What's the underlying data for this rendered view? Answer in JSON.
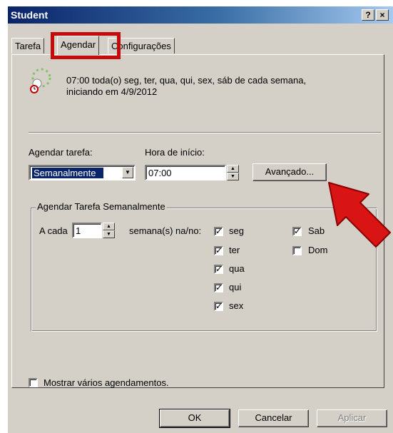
{
  "window": {
    "title": "Student",
    "help_label": "?",
    "close_label": "×"
  },
  "tabs": [
    {
      "label": "Tarefa"
    },
    {
      "label": "Agendar"
    },
    {
      "label": "Configurações"
    }
  ],
  "schedule": {
    "summary_line1": "07:00 toda(o) seg, ter, qua, qui, sex, sáb de cada semana,",
    "summary_line2": "iniciando em 4/9/2012",
    "task_label": "Agendar tarefa:",
    "task_value": "Semanalmente",
    "start_label": "Hora de início:",
    "start_value": "07:00",
    "advanced_label": "Avançado..."
  },
  "weekly": {
    "group_title": "Agendar Tarefa Semanalmente",
    "every_label": "A cada",
    "every_value": "1",
    "weeks_label": "semana(s) na/no:",
    "days": [
      {
        "label": "seg",
        "checked": true
      },
      {
        "label": "ter",
        "checked": true
      },
      {
        "label": "qua",
        "checked": true
      },
      {
        "label": "qui",
        "checked": true
      },
      {
        "label": "sex",
        "checked": true
      },
      {
        "label": "Sab",
        "checked": true
      },
      {
        "label": "Dom",
        "checked": false
      }
    ]
  },
  "multi_schedule_label": "Mostrar vários agendamentos.",
  "footer": {
    "ok": "OK",
    "cancel": "Cancelar",
    "apply": "Aplicar"
  },
  "colors": {
    "annotation": "#c40a0a",
    "titlebar": "#0a246a",
    "dialog_bg": "#d4d0c8"
  }
}
